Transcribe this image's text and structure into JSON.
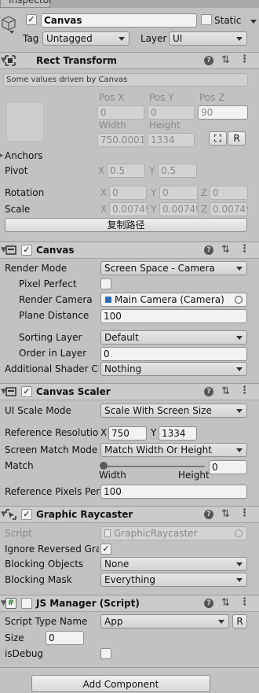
{
  "window": {
    "tab_label": "Inspector"
  },
  "go": {
    "name": "Canvas",
    "static_label": "Static",
    "tag_label": "Tag",
    "tag_value": "Untagged",
    "layer_label": "Layer",
    "layer_value": "UI"
  },
  "rect": {
    "title": "Rect Transform",
    "driven_note": "Some values driven by Canvas",
    "pos_x_label": "Pos X",
    "pos_y_label": "Pos Y",
    "pos_z_label": "Pos Z",
    "pos_x": "0",
    "pos_y": "0",
    "pos_z": "90",
    "width_label": "Width",
    "height_label": "Height",
    "width": "750.0001",
    "height": "1334",
    "r_button": "R",
    "anchors_label": "Anchors",
    "pivot_label": "Pivot",
    "pivot_x": "0.5",
    "pivot_y": "0.5",
    "rotation_label": "Rotation",
    "rot_x": "0",
    "rot_y": "0",
    "rot_z": "0",
    "scale_label": "Scale",
    "scale_x": "0.00749",
    "scale_y": "0.00749",
    "scale_z": "0.00749",
    "x": "X",
    "y": "Y",
    "z": "Z",
    "copy_path_button": "复制路径"
  },
  "canvas": {
    "title": "Canvas",
    "render_mode_label": "Render Mode",
    "render_mode": "Screen Space - Camera",
    "pixel_perfect_label": "Pixel Perfect",
    "render_camera_label": "Render Camera",
    "render_camera": "Main Camera (Camera)",
    "plane_distance_label": "Plane Distance",
    "plane_distance": "100",
    "sorting_layer_label": "Sorting Layer",
    "sorting_layer": "Default",
    "order_label": "Order in Layer",
    "order": "0",
    "shader_label": "Additional Shader Ch",
    "shader": "Nothing"
  },
  "scaler": {
    "title": "Canvas Scaler",
    "ui_scale_label": "UI Scale Mode",
    "ui_scale": "Scale With Screen Size",
    "ref_res_label": "Reference Resolutio",
    "ref_x": "750",
    "ref_y": "1334",
    "match_mode_label": "Screen Match Mode",
    "match_mode": "Match Width Or Height",
    "match_label": "Match",
    "match_value": "0",
    "match_fraction": 0,
    "width_hint": "Width",
    "height_hint": "Height",
    "ppu_label": "Reference Pixels Per",
    "ppu": "100"
  },
  "raycaster": {
    "title": "Graphic Raycaster",
    "script_label": "Script",
    "script": "GraphicRaycaster",
    "ignore_label": "Ignore Reversed Gra",
    "blocking_objects_label": "Blocking Objects",
    "blocking_objects": "None",
    "blocking_mask_label": "Blocking Mask",
    "blocking_mask": "Everything"
  },
  "jsm": {
    "title": "JS Manager (Script)",
    "type_label": "Script Type Name",
    "type": "App",
    "r_button": "R",
    "size_label": "Size",
    "size": "0",
    "debug_label": "isDebug"
  },
  "add_component": "Add Component",
  "colors": {
    "component_icon": "#3a3a3a",
    "camera_icon": "#2a6fb5"
  }
}
